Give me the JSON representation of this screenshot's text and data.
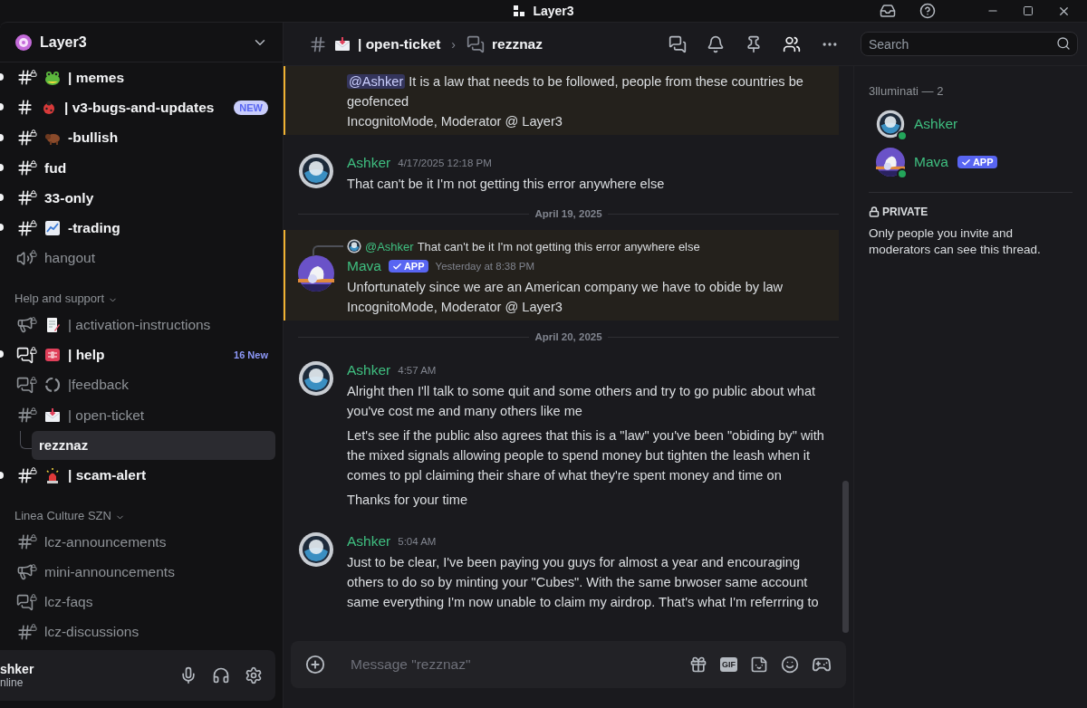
{
  "titlebar": {
    "title": "Layer3"
  },
  "server": {
    "name": "Layer3"
  },
  "channels": [
    {
      "kind": "text",
      "locked": true,
      "name": "| memes",
      "unread": true
    },
    {
      "kind": "text",
      "locked": false,
      "name": "| v3-bugs-and-updates",
      "unread": true,
      "badge": {
        "kind": "pill",
        "text": "NEW"
      }
    },
    {
      "kind": "text",
      "locked": true,
      "name": "-bullish",
      "unread": true
    },
    {
      "kind": "text",
      "locked": true,
      "name": "fud",
      "unread": true
    },
    {
      "kind": "text",
      "locked": true,
      "name": "33-only",
      "unread": true
    },
    {
      "kind": "text",
      "locked": true,
      "name": "-trading",
      "unread": true
    },
    {
      "kind": "voice",
      "locked": true,
      "name": "hangout",
      "unread": false
    },
    {
      "kind": "category",
      "name": "Help and support"
    },
    {
      "kind": "announcement",
      "locked": true,
      "name": "| activation-instructions",
      "unread": false
    },
    {
      "kind": "forum",
      "locked": true,
      "name": "| help",
      "unread": true,
      "badge": {
        "kind": "count",
        "text": "16 New"
      }
    },
    {
      "kind": "forum",
      "locked": true,
      "name": "|feedback",
      "unread": false
    },
    {
      "kind": "text",
      "locked": true,
      "name": "| open-ticket",
      "unread": false
    },
    {
      "kind": "thread",
      "name": "rezznaz",
      "selected": true
    },
    {
      "kind": "text",
      "locked": true,
      "name": "| scam-alert",
      "unread": true
    },
    {
      "kind": "category",
      "name": "Linea Culture SZN"
    },
    {
      "kind": "text",
      "locked": true,
      "name": "lcz-announcements",
      "unread": false
    },
    {
      "kind": "announcement",
      "locked": true,
      "name": "mini-announcements",
      "unread": false
    },
    {
      "kind": "forum",
      "locked": true,
      "name": "lcz-faqs",
      "unread": false
    },
    {
      "kind": "text",
      "locked": true,
      "name": "lcz-discussions",
      "unread": false
    }
  ],
  "user_panel": {
    "name": "shker",
    "status": "nline"
  },
  "header": {
    "parent_channel": "| open-ticket",
    "separator": "›",
    "thread": "rezznaz",
    "members_active": true
  },
  "search": {
    "placeholder": "Search"
  },
  "messages": [
    {
      "kind": "continuation",
      "highlighted": true,
      "mention": "@Ashker",
      "paragraphs": [
        [
          "It is a law that needs to be followed, people from these countries be geofenced",
          "IncognitoMode, Moderator @ Layer3"
        ]
      ]
    },
    {
      "kind": "message",
      "highlighted": false,
      "author": "Ashker",
      "time": "4/17/2025 12:18 PM",
      "paragraphs": [
        [
          "That can't be it I'm not getting this error anywhere else"
        ]
      ]
    },
    {
      "kind": "divider",
      "text": "April 19, 2025"
    },
    {
      "kind": "message",
      "highlighted": true,
      "author": "Mava",
      "app_badge": "APP",
      "time": "Yesterday at 8:38 PM",
      "reply": {
        "author": "@Ashker",
        "text": "That can't be it I'm not getting this error anywhere else"
      },
      "paragraphs": [
        [
          "Unfortunately since we are an American company we have to obide by law",
          "IncognitoMode, Moderator @ Layer3"
        ]
      ]
    },
    {
      "kind": "divider",
      "text": "April 20, 2025"
    },
    {
      "kind": "message",
      "highlighted": false,
      "author": "Ashker",
      "time": "4:57 AM",
      "paragraphs": [
        [
          "Alright then I'll talk to some quit and some others and try to go public about what you've cost me and many others like me"
        ],
        [
          "Let's see if the public also agrees that this is a \"law\" you've been \"obiding by\" with the mixed signals allowing people to spend money but tighten the leash when it comes to ppl claiming their share of what they're spent money and time on"
        ],
        [
          "Thanks for your time"
        ]
      ]
    },
    {
      "kind": "message",
      "highlighted": false,
      "author": "Ashker",
      "time": "5:04 AM",
      "paragraphs": [
        [
          "Just to be clear, I've been paying you guys for almost a year and encouraging others to do so by minting your \"Cubes\". With the same brwoser same account same everything I'm now unable to claim my airdrop. That's what I'm referrring to"
        ]
      ]
    }
  ],
  "composer": {
    "placeholder": "Message \"rezznaz\"",
    "gif_label": "GIF"
  },
  "members": {
    "heading": "3lluminati — 2",
    "list": [
      {
        "name": "Ashker",
        "online": true
      },
      {
        "name": "Mava",
        "online": true,
        "app_badge": "APP"
      }
    ]
  },
  "privacy": {
    "title": "PRIVATE",
    "text": "Only people you invite and moderators can see this thread."
  }
}
